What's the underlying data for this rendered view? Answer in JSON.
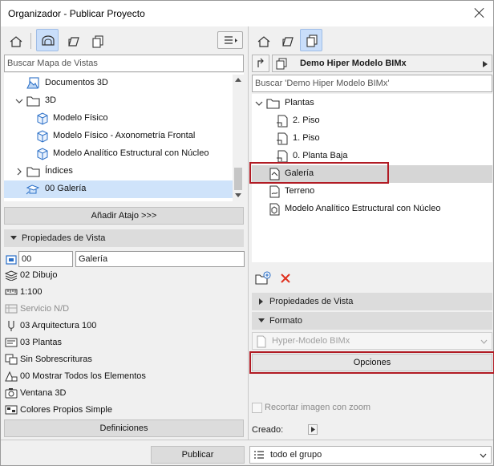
{
  "window": {
    "title": "Organizador - Publicar Proyecto"
  },
  "left": {
    "search_placeholder": "Buscar Mapa de Vistas",
    "tree": [
      {
        "label": "Documentos 3D",
        "icon": "documents-3d-icon"
      },
      {
        "label": "3D",
        "icon": "folder-icon"
      },
      {
        "label": "Modelo Físico",
        "icon": "cube-icon"
      },
      {
        "label": "Modelo Físico - Axonometría Frontal",
        "icon": "cube-icon"
      },
      {
        "label": "Modelo Analítico Estructural con Núcleo",
        "icon": "cube-icon"
      },
      {
        "label": "Índices",
        "icon": "folder-icon"
      },
      {
        "label": "00 Galería",
        "icon": "gallery-view-icon",
        "selected": true
      }
    ],
    "add_shortcut_label": "Añadir Atajo >>>",
    "view_props_header": "Propiedades de Vista",
    "view_id": "00",
    "view_name": "Galería",
    "properties": [
      {
        "label": "02 Dibujo",
        "icon": "layer-combination-icon"
      },
      {
        "label": "1:100",
        "icon": "scale-icon"
      },
      {
        "label": "Servicio N/D",
        "icon": "structure-display-icon",
        "disabled": true
      },
      {
        "label": "03 Arquitectura 100",
        "icon": "pen-set-icon"
      },
      {
        "label": "03 Plantas",
        "icon": "model-view-options-icon"
      },
      {
        "label": "Sin Sobrescrituras",
        "icon": "graphic-override-icon"
      },
      {
        "label": "00 Mostrar Todos los Elementos",
        "icon": "renovation-filter-icon"
      },
      {
        "label": "Ventana 3D",
        "icon": "camera-icon"
      },
      {
        "label": "Colores Propios Simple",
        "icon": "palette-icon"
      }
    ],
    "definitions_label": "Definiciones"
  },
  "right": {
    "set_name": "Demo Hiper Modelo BIMx",
    "search_placeholder": "Buscar 'Demo Hiper Modelo BIMx'",
    "tree": [
      {
        "label": "Plantas",
        "icon": "folder-icon"
      },
      {
        "label": "2. Piso",
        "icon": "floor-plan-icon"
      },
      {
        "label": "1. Piso",
        "icon": "floor-plan-icon"
      },
      {
        "label": "0. Planta Baja",
        "icon": "floor-plan-icon"
      },
      {
        "label": "Galería",
        "icon": "gallery-view-icon",
        "selected": true
      },
      {
        "label": "Terreno",
        "icon": "terrain-view-icon"
      },
      {
        "label": "Modelo Analítico Estructural con Núcleo",
        "icon": "document-3d-icon"
      }
    ],
    "view_props_header": "Propiedades de Vista",
    "format_header": "Formato",
    "format_value": "Hyper-Modelo BIMx",
    "options_label": "Opciones",
    "crop_label": "Recortar imagen con zoom",
    "created_label": "Creado:"
  },
  "footer": {
    "publish_label": "Publicar",
    "scope_value": "todo el grupo"
  },
  "colors": {
    "selection": "#cfe3fa",
    "selection_gray": "#d6d6d6",
    "highlight_box": "#b11b24",
    "delete_red": "#e0301e",
    "icon_blue": "#2a6fc7"
  }
}
